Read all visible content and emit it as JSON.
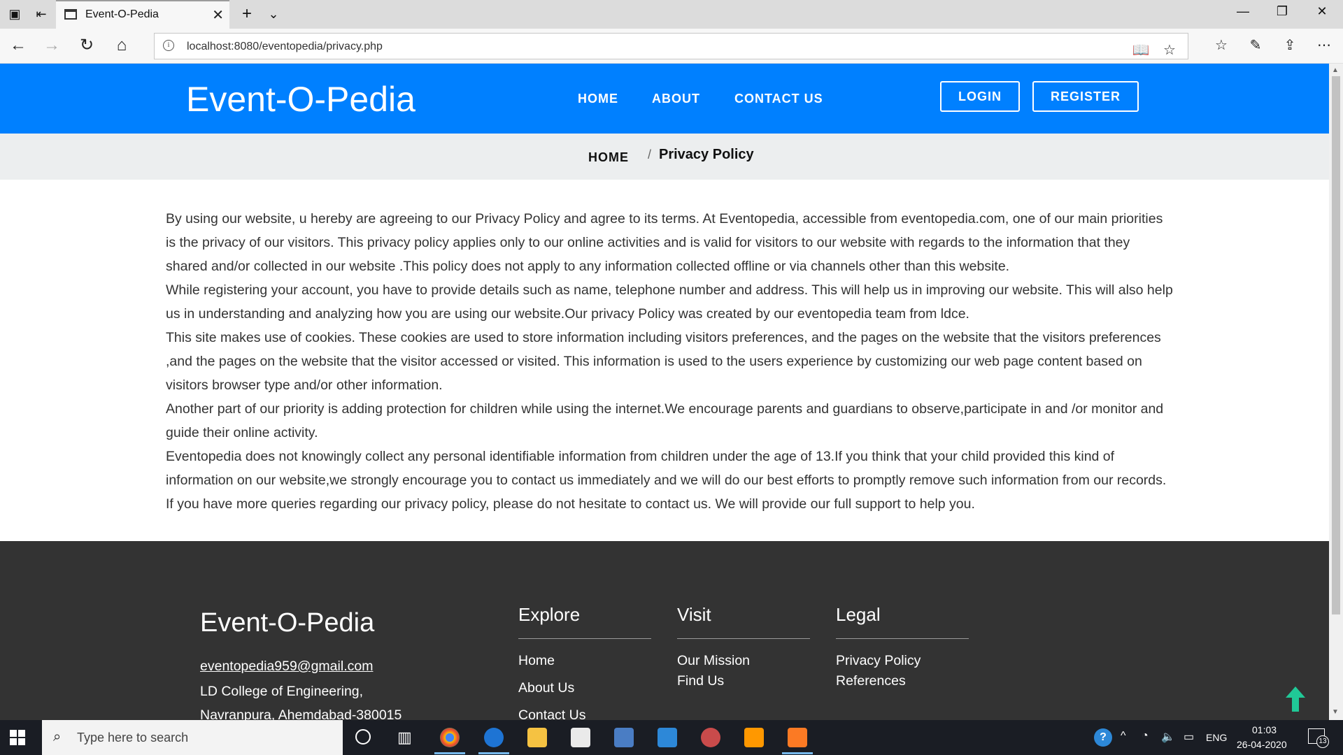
{
  "browser": {
    "tab_title": "Event-O-Pedia",
    "url": "localhost:8080/eventopedia/privacy.php"
  },
  "header": {
    "brand": "Event-O-Pedia",
    "nav": [
      "HOME",
      "ABOUT",
      "CONTACT US"
    ],
    "login": "LOGIN",
    "register": "REGISTER"
  },
  "breadcrumb": {
    "home": "HOME",
    "separator": "/",
    "current": "Privacy Policy"
  },
  "policy": [
    "By using our website, u hereby are agreeing to our Privacy Policy and agree to its terms. At Eventopedia, accessible from eventopedia.com, one of our main priorities is the privacy of our visitors. This privacy policy applies only to our online activities and is valid for visitors to our website with regards to the information that they shared and/or collected in our website .This policy does not apply to any information collected offline or via channels other than this website.",
    "While registering your account, you have to provide details such as name, telephone number and address. This will help us in improving our website. This will also help us in understanding and analyzing how you are using our website.Our privacy Policy was created by our eventopedia team from ldce.",
    "This site makes use of cookies. These cookies are used to store information including visitors preferences, and the pages on the website that the visitors preferences ,and the pages on the website that the visitor accessed or visited. This information is used to the users experience by customizing our web page content based on visitors browser type and/or other information.",
    "Another part of our priority is adding protection for children while using the internet.We encourage parents and guardians to observe,participate in and /or monitor and guide their online activity.",
    "Eventopedia does not knowingly collect any personal identifiable information from children under the age of 13.If you think that your child provided this kind of information on our website,we strongly encourage you to contact us immediately and we will do our best efforts to promptly remove such information from our records.",
    "If you have more queries regarding our privacy policy, please do not hesitate to contact us. We will provide our full support to help you."
  ],
  "footer": {
    "brand": "Event-O-Pedia",
    "email": "eventopedia959@gmail.com",
    "address_line1": "LD College of Engineering,",
    "address_line2": "Navranpura, Ahemdabad-380015",
    "explore": {
      "heading": "Explore",
      "links": [
        "Home",
        "About Us",
        "Contact Us"
      ]
    },
    "visit": {
      "heading": "Visit",
      "links": [
        "Our Mission",
        "Find Us"
      ]
    },
    "legal": {
      "heading": "Legal",
      "links": [
        "Privacy Policy",
        "References"
      ]
    }
  },
  "taskbar": {
    "search_placeholder": "Type here to search",
    "language": "ENG",
    "time": "01:03",
    "date": "26-04-2020",
    "notifications": "13"
  },
  "colors": {
    "header_bg": "#0080ff",
    "breadcrumb_bg": "#eceeef",
    "footer_bg": "#333333",
    "back_to_top": "#20c997"
  }
}
